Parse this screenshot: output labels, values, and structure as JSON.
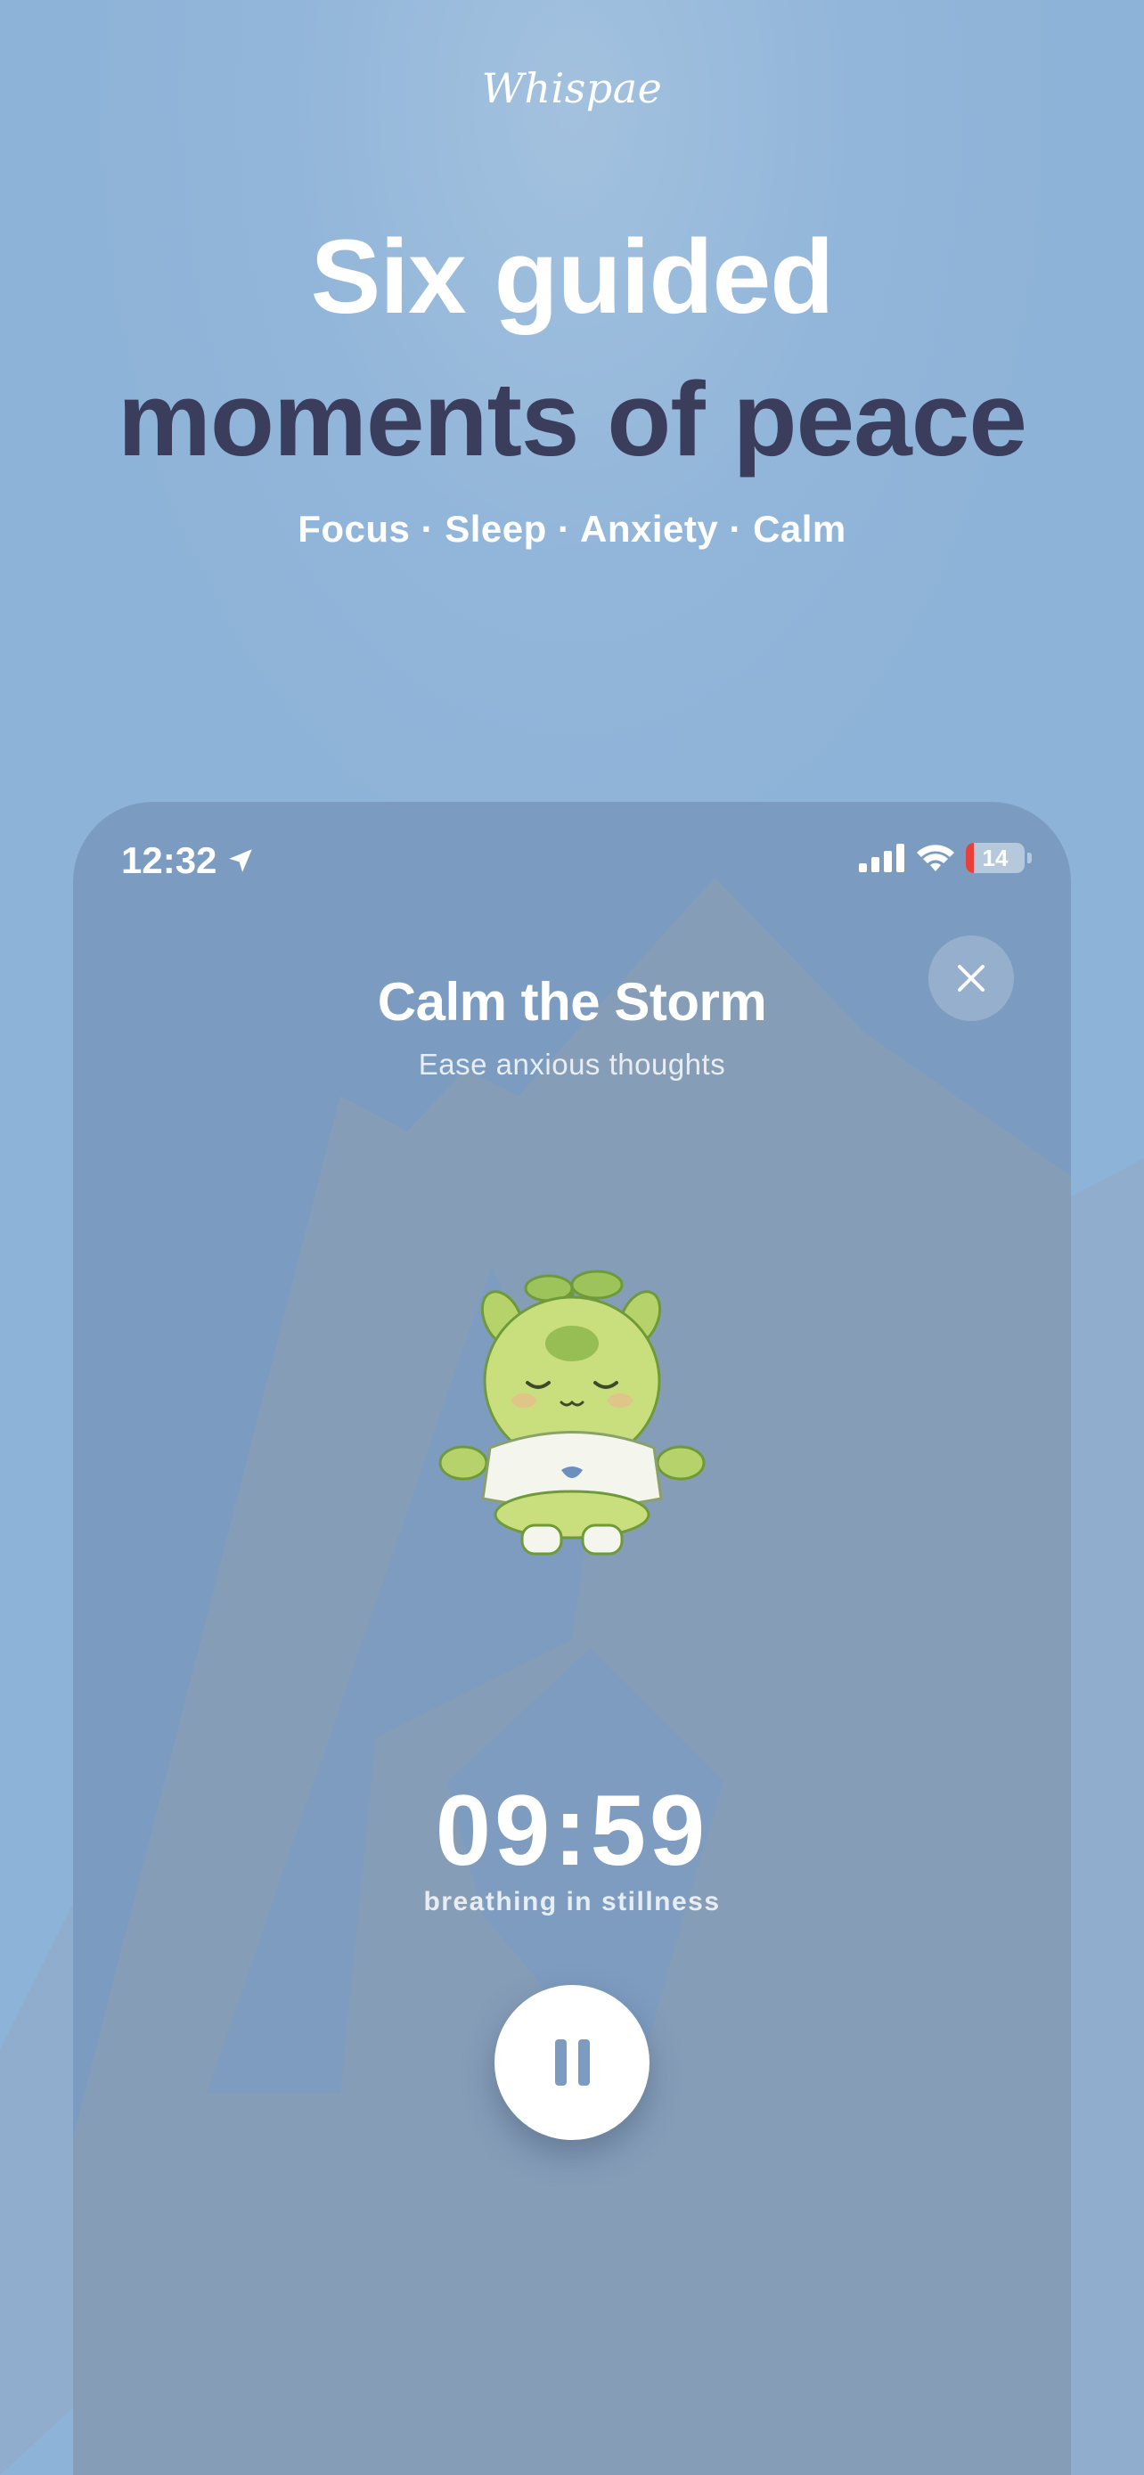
{
  "brand": "Whispae",
  "headline": {
    "line1": "Six guided",
    "line2": "moments of peace"
  },
  "tagline": "Focus · Sleep · Anxiety · Calm",
  "status_bar": {
    "time": "12:32",
    "battery": "14"
  },
  "session": {
    "title": "Calm the Storm",
    "subtitle": "Ease anxious thoughts",
    "timer": "09:59",
    "caption": "breathing in stillness"
  },
  "icons": {
    "location": "location-arrow-icon",
    "signal": "cellular-signal-icon",
    "wifi": "wifi-icon",
    "close": "close-icon",
    "pause": "pause-icon"
  },
  "colors": {
    "background": "#8eb3d8",
    "headline_dark": "#3b3d5c",
    "phone_bg": "#7b9cc0",
    "battery_low": "#e8403a"
  }
}
